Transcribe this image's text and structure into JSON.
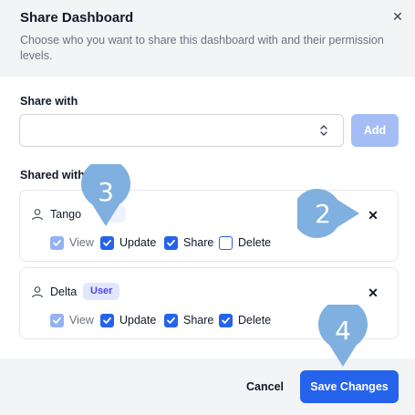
{
  "dialog": {
    "title": "Share Dashboard",
    "subtitle": "Choose who you want to share this dashboard with and their permission levels.",
    "close_icon": "close-icon"
  },
  "share_with": {
    "label": "Share with",
    "select_value": "",
    "add_label": "Add"
  },
  "shared_with": {
    "label": "Shared with",
    "users": [
      {
        "name": "Tango",
        "role": "",
        "permissions": [
          {
            "label": "View",
            "checked": true,
            "disabled": true
          },
          {
            "label": "Update",
            "checked": true,
            "disabled": false
          },
          {
            "label": "Share",
            "checked": true,
            "disabled": false
          },
          {
            "label": "Delete",
            "checked": false,
            "disabled": false
          }
        ]
      },
      {
        "name": "Delta",
        "role": "User",
        "permissions": [
          {
            "label": "View",
            "checked": true,
            "disabled": true
          },
          {
            "label": "Update",
            "checked": true,
            "disabled": false
          },
          {
            "label": "Share",
            "checked": true,
            "disabled": false
          },
          {
            "label": "Delete",
            "checked": true,
            "disabled": false
          }
        ]
      }
    ]
  },
  "footer": {
    "cancel_label": "Cancel",
    "save_label": "Save Changes"
  },
  "callouts": [
    "3",
    "2",
    "4"
  ],
  "colors": {
    "primary": "#2563eb",
    "primary_disabled": "#a5bdf5",
    "callout": "#7fb0df"
  }
}
